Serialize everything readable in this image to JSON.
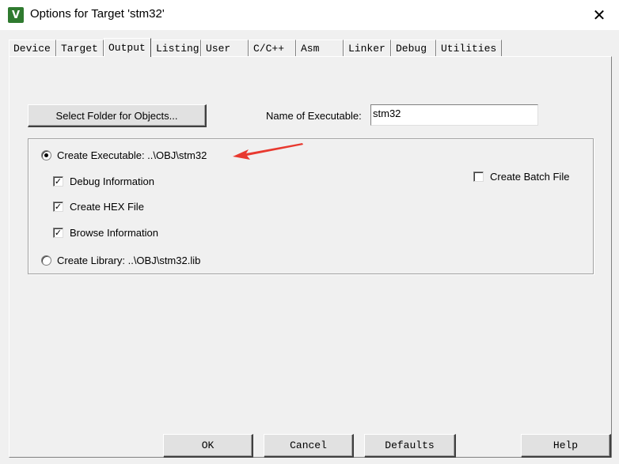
{
  "window": {
    "title": "Options for Target 'stm32'",
    "icon": "keil-uvision-icon",
    "close_glyph": "✕"
  },
  "tabs": [
    {
      "label": "Device"
    },
    {
      "label": "Target"
    },
    {
      "label": "Output"
    },
    {
      "label": "Listing"
    },
    {
      "label": "User"
    },
    {
      "label": "C/C++"
    },
    {
      "label": "Asm"
    },
    {
      "label": "Linker"
    },
    {
      "label": "Debug"
    },
    {
      "label": "Utilities"
    }
  ],
  "active_tab": "Output",
  "output": {
    "select_folder_label": "Select Folder for Objects...",
    "name_label": "Name of Executable:",
    "name_value": "stm32",
    "create_executable_label": "Create Executable:  ..\\OBJ\\stm32",
    "create_executable_selected": true,
    "debug_info_label": "Debug Information",
    "debug_info_checked": true,
    "hex_label": "Create HEX File",
    "hex_checked": true,
    "browse_label": "Browse Information",
    "browse_checked": true,
    "create_library_label": "Create Library:  ..\\OBJ\\stm32.lib",
    "create_library_selected": false,
    "batch_label": "Create Batch File",
    "batch_checked": false
  },
  "buttons": {
    "ok": "OK",
    "cancel": "Cancel",
    "defaults": "Defaults",
    "help": "Help"
  },
  "colors": {
    "annotation_arrow": "#e8392f",
    "dialog_bg": "#f0f0f0"
  }
}
